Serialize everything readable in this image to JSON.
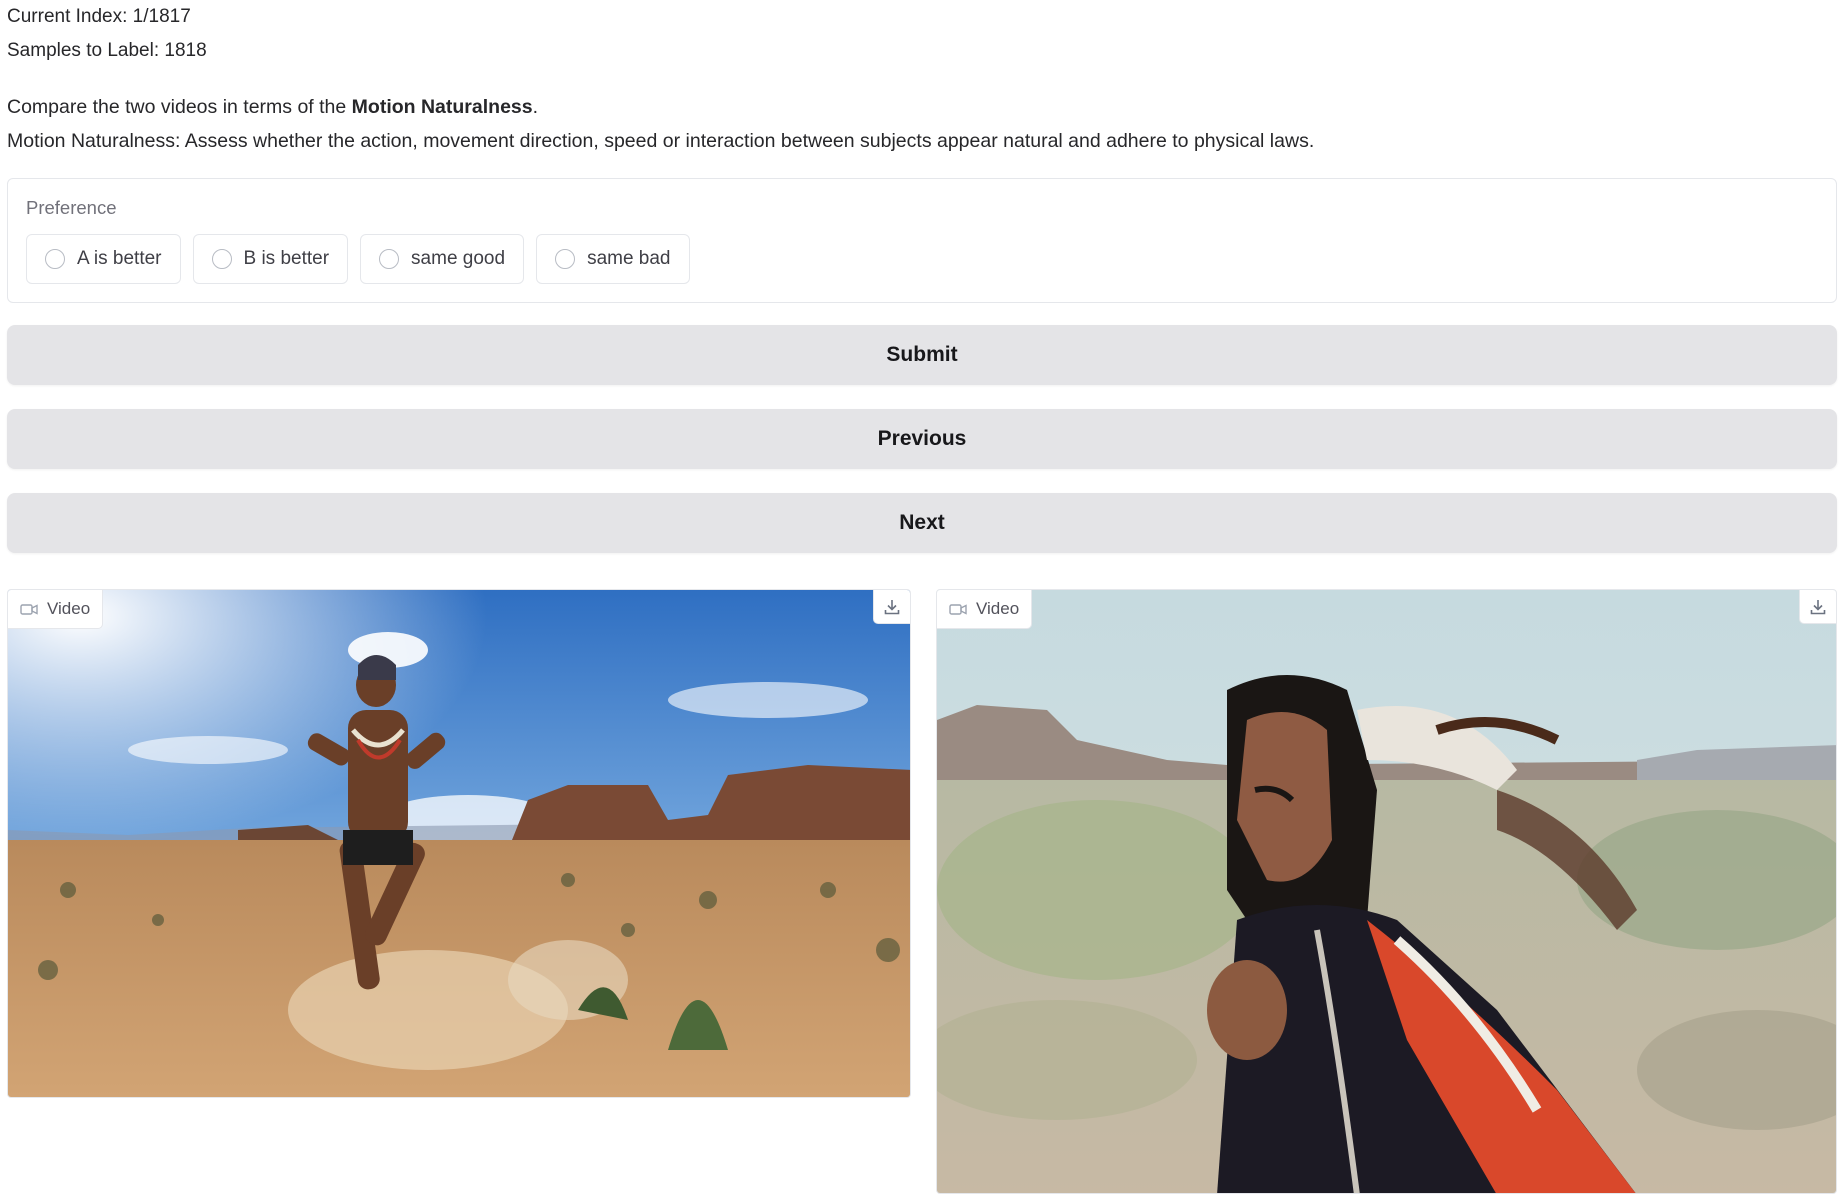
{
  "header": {
    "current_index": "Current Index: 1/1817",
    "samples_to_label": "Samples to Label: 1818"
  },
  "task": {
    "prefix": "Compare the two videos in terms of the ",
    "criterion": "Motion Naturalness",
    "suffix": ".",
    "description": "Motion Naturalness: Assess whether the action, movement direction, speed or interaction between subjects appear natural and adhere to physical laws."
  },
  "preference": {
    "label": "Preference",
    "options": [
      "A is better",
      "B is better",
      "same good",
      "same bad"
    ]
  },
  "buttons": {
    "submit": "Submit",
    "previous": "Previous",
    "next": "Next"
  },
  "videos": {
    "a": {
      "badge": "Video",
      "icon": "video-camera-icon",
      "download_icon": "download-icon"
    },
    "b": {
      "badge": "Video",
      "icon": "video-camera-icon",
      "download_icon": "download-icon"
    }
  },
  "colors": {
    "button_bg": "#e4e4e7",
    "border": "#e5e7eb",
    "text": "#27272a"
  }
}
